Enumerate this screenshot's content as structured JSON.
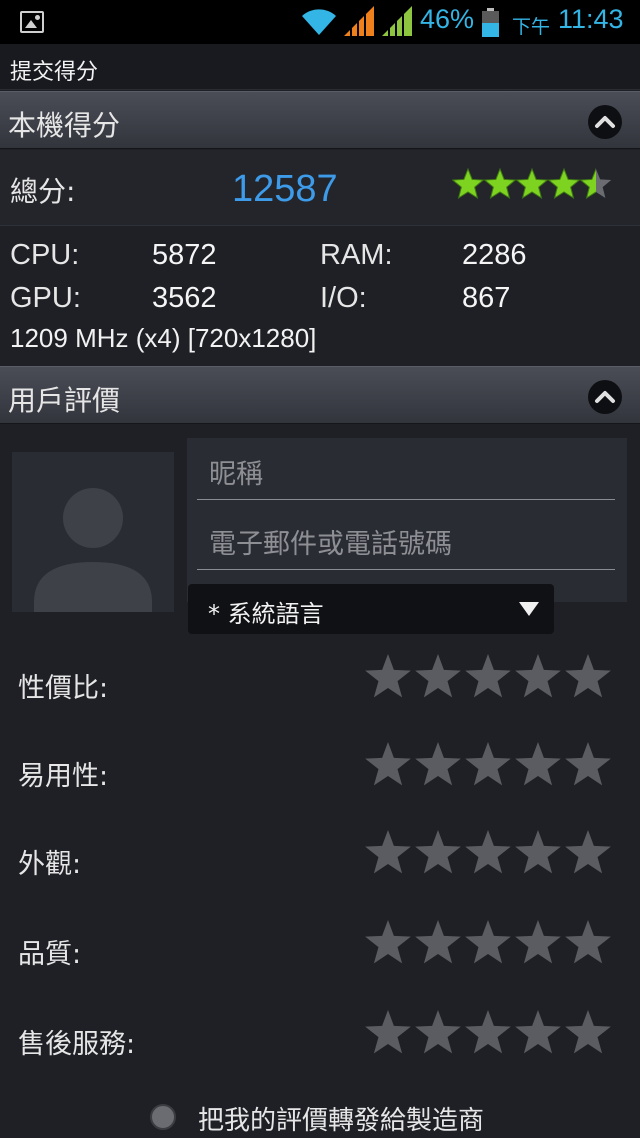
{
  "status_bar": {
    "battery_percent": "46%",
    "ampm": "下午",
    "time": "11:43",
    "accent_color": "#33b5e5"
  },
  "title_bar": {
    "title": "提交得分"
  },
  "device_score": {
    "header": "本機得分",
    "total_label": "總分:",
    "total_value": "12587",
    "star_rating": 4.5,
    "stats": [
      {
        "label": "CPU:",
        "value": "5872"
      },
      {
        "label": "RAM:",
        "value": "2286"
      },
      {
        "label": "GPU:",
        "value": "3562"
      },
      {
        "label": "I/O:",
        "value": "867"
      }
    ],
    "cpu_info": "1209 MHz (x4) [720x1280]"
  },
  "user_review": {
    "header": "用戶評價",
    "nickname_placeholder": "昵稱",
    "contact_placeholder": "電子郵件或電話號碼",
    "language_selected": "* 系統語言",
    "ratings": [
      {
        "label": "性價比:",
        "value": 0
      },
      {
        "label": "易用性:",
        "value": 0
      },
      {
        "label": "外觀:",
        "value": 0
      },
      {
        "label": "品質:",
        "value": 0
      },
      {
        "label": "售後服務:",
        "value": 0
      }
    ],
    "forward_label": "把我的評價轉發給製造商"
  },
  "icons": {
    "gallery": "image-icon",
    "wifi": "wifi-icon",
    "signal": "signal-icon",
    "battery": "battery-icon",
    "collapse": "chevron-up-icon",
    "dropdown": "triangle-down-icon",
    "star": "star-icon"
  },
  "colors": {
    "score_blue": "#3d9be9",
    "star_green": "#7ed321",
    "star_empty": "#5a5c62"
  }
}
